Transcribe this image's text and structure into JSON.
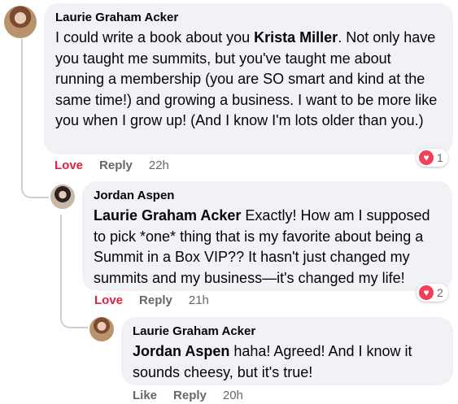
{
  "comments": [
    {
      "author": "Laurie Graham Acker",
      "mention": "",
      "text_before": "I could write a book about you ",
      "text_mention": "Krista Miller",
      "text_after": ". Not only have you taught me summits, but you've taught me about running a membership (you are SO smart and kind at the same time!) and growing a business. I want to be more like you when I grow up! (And I know I'm lots older than you.)",
      "reaction_count": "1",
      "reaction_icon": "heart-icon",
      "like_label": "Love",
      "reply_label": "Reply",
      "time": "22h"
    },
    {
      "author": "Jordan Aspen",
      "mention": "Laurie Graham Acker",
      "text": " Exactly! How am I supposed to pick *one* thing that is my favorite about being a Summit in a Box VIP?? It hasn't just changed my summits and my business—it's changed my life!",
      "reaction_count": "2",
      "reaction_icon": "heart-icon",
      "like_label": "Love",
      "reply_label": "Reply",
      "time": "21h"
    },
    {
      "author": "Laurie Graham Acker",
      "mention": "Jordan Aspen",
      "text": " haha! Agreed! And I know it sounds cheesy, but it's true!",
      "like_label": "Like",
      "reply_label": "Reply",
      "time": "20h"
    }
  ],
  "colors": {
    "bubble": "#f0f2f5",
    "love": "#e41e3f",
    "meta": "#65676b",
    "heart": "#f33e58"
  }
}
